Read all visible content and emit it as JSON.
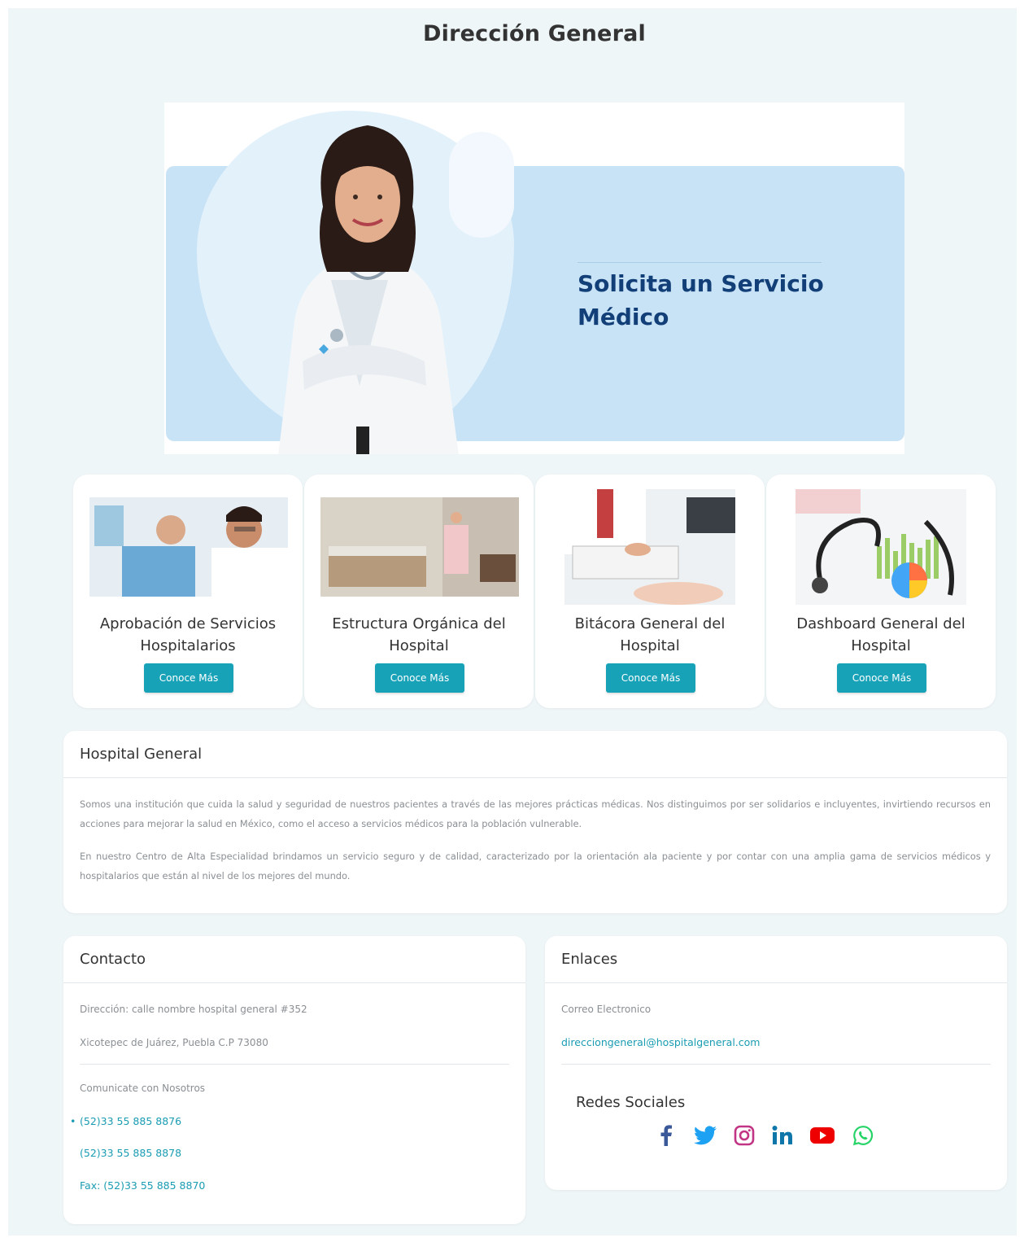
{
  "page": {
    "title": "Dirección General"
  },
  "hero": {
    "headline_line1": "Solicita un Servicio",
    "headline_line2": "Médico"
  },
  "cards": [
    {
      "title_line1": "Aprobación de Servicios",
      "title_line2": "Hospitalarios",
      "button": "Conoce Más"
    },
    {
      "title_line1": "Estructura Orgánica del",
      "title_line2": "Hospital",
      "button": "Conoce Más"
    },
    {
      "title_line1": "Bitácora General del",
      "title_line2": "Hospital",
      "button": "Conoce Más"
    },
    {
      "title_line1": "Dashboard General del",
      "title_line2": "Hospital",
      "button": "Conoce Más"
    }
  ],
  "about": {
    "title": "Hospital General",
    "p1": "Somos una institución que cuida la salud y seguridad de nuestros pacientes a través de las mejores prácticas médicas. Nos distinguimos por ser solidarios e incluyentes, invirtiendo recursos en acciones para mejorar la salud en México, como el acceso a servicios médicos para la población vulnerable.",
    "p2": "En nuestro Centro de Alta Especialidad brindamos un servicio seguro y de calidad, caracterizado por la orientación ala paciente y por contar con una amplia gama de servicios médicos y hospitalarios que están al nivel de los mejores del mundo."
  },
  "contact": {
    "title": "Contacto",
    "address": "Dirección: calle nombre hospital general #352",
    "city": "Xicotepec de Juárez, Puebla C.P 73080",
    "reach_label": "Comunicate con Nosotros",
    "phone1": "(52)33 55 885 8876",
    "phone2": "(52)33 55 885 8878",
    "fax": "Fax: (52)33 55 885 8870"
  },
  "links": {
    "title": "Enlaces",
    "email_label": "Correo Electronico",
    "email": "direcciongeneral@hospitalgeneral.com",
    "social_title": "Redes Sociales"
  },
  "icons": [
    "facebook-icon",
    "twitter-icon",
    "instagram-icon",
    "linkedin-icon",
    "youtube-icon",
    "whatsapp-icon"
  ],
  "colors": {
    "accent": "#17a2b8",
    "link": "#1a9cb2",
    "heading_blue": "#123f78",
    "hero_panel": "#c9e3f6",
    "background": "#eff6f8"
  }
}
